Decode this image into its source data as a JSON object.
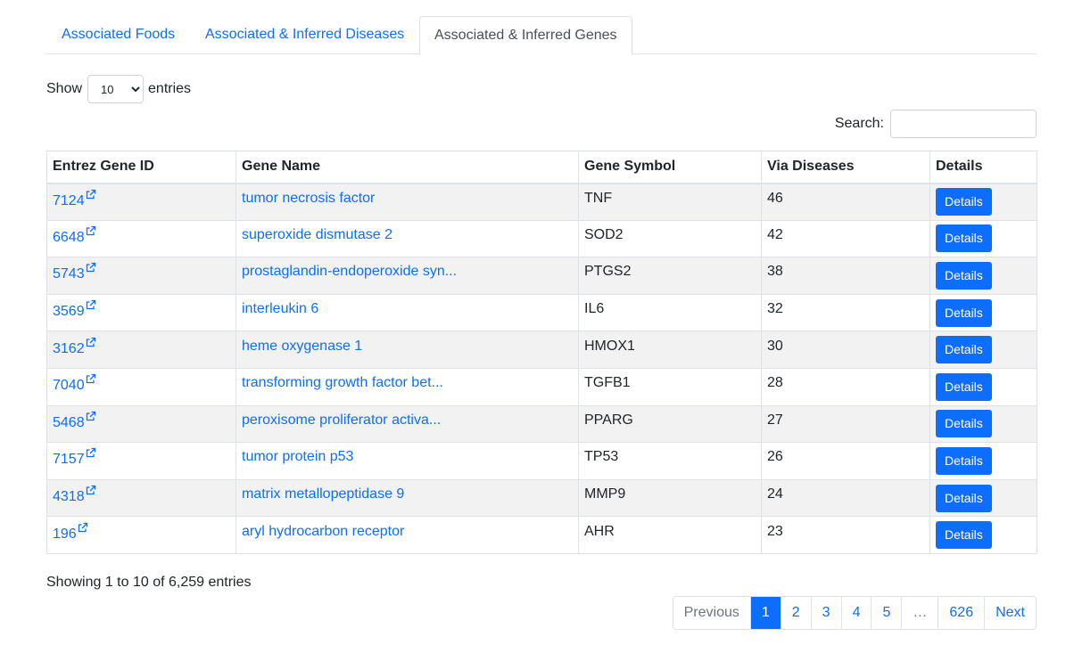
{
  "tabs": [
    {
      "label": "Associated Foods"
    },
    {
      "label": "Associated & Inferred Diseases"
    },
    {
      "label": "Associated & Inferred Genes"
    }
  ],
  "length_control": {
    "prefix": "Show",
    "selected": "10",
    "suffix": "entries"
  },
  "search": {
    "label": "Search:",
    "value": ""
  },
  "table": {
    "headers": [
      "Entrez Gene ID",
      "Gene Name",
      "Gene Symbol",
      "Via Diseases",
      "Details"
    ],
    "details_label": "Details",
    "rows": [
      {
        "id": "7124",
        "name": "tumor necrosis factor",
        "symbol": "TNF",
        "via": "46"
      },
      {
        "id": "6648",
        "name": "superoxide dismutase 2",
        "symbol": "SOD2",
        "via": "42"
      },
      {
        "id": "5743",
        "name": "prostaglandin-endoperoxide syn...",
        "symbol": "PTGS2",
        "via": "38"
      },
      {
        "id": "3569",
        "name": "interleukin 6",
        "symbol": "IL6",
        "via": "32"
      },
      {
        "id": "3162",
        "name": "heme oxygenase 1",
        "symbol": "HMOX1",
        "via": "30"
      },
      {
        "id": "7040",
        "name": "transforming growth factor bet...",
        "symbol": "TGFB1",
        "via": "28"
      },
      {
        "id": "5468",
        "name": "peroxisome proliferator activa...",
        "symbol": "PPARG",
        "via": "27"
      },
      {
        "id": "7157",
        "name": "tumor protein p53",
        "symbol": "TP53",
        "via": "26"
      },
      {
        "id": "4318",
        "name": "matrix metallopeptidase 9",
        "symbol": "MMP9",
        "via": "24"
      },
      {
        "id": "196",
        "name": "aryl hydrocarbon receptor",
        "symbol": "AHR",
        "via": "23"
      }
    ]
  },
  "info": "Showing 1 to 10 of 6,259 entries",
  "pagination": {
    "previous": "Previous",
    "pages": [
      "1",
      "2",
      "3",
      "4",
      "5"
    ],
    "ellipsis": "…",
    "last": "626",
    "next": "Next"
  },
  "icons": {
    "external_link": "external-link-icon"
  },
  "colors": {
    "link": "#0d6efd",
    "button": "#0d6efd",
    "stripe": "#f2f2f2"
  }
}
